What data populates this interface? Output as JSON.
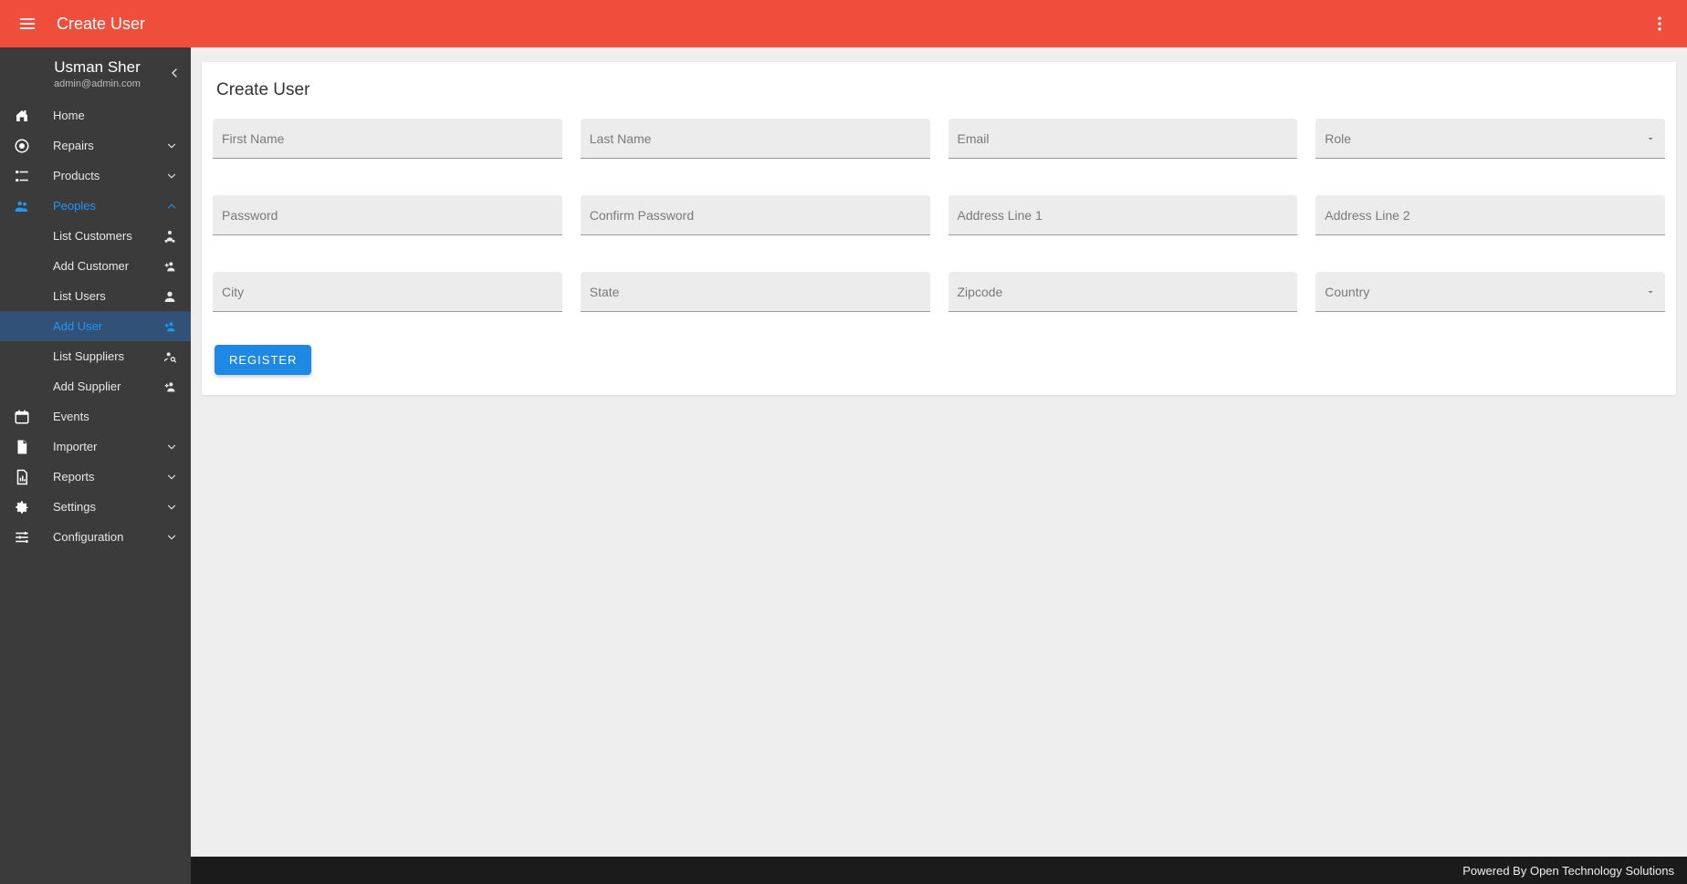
{
  "topbar": {
    "title": "Create User"
  },
  "user": {
    "name": "Usman Sher",
    "email": "admin@admin.com"
  },
  "sidebar": {
    "home": "Home",
    "repairs": "Repairs",
    "products": "Products",
    "peoples": "Peoples",
    "peoples_sub": {
      "list_customers": "List Customers",
      "add_customer": "Add Customer",
      "list_users": "List Users",
      "add_user": "Add User",
      "list_suppliers": "List Suppliers",
      "add_supplier": "Add Supplier"
    },
    "events": "Events",
    "importer": "Importer",
    "reports": "Reports",
    "settings": "Settings",
    "configuration": "Configuration"
  },
  "card": {
    "title": "Create User"
  },
  "form": {
    "first_name": "First Name",
    "last_name": "Last Name",
    "email": "Email",
    "role": "Role",
    "password": "Password",
    "confirm_password": "Confirm Password",
    "address1": "Address Line 1",
    "address2": "Address Line 2",
    "city": "City",
    "state": "State",
    "zipcode": "Zipcode",
    "country": "Country",
    "register": "REGISTER"
  },
  "footer": {
    "text": "Powered By Open Technology Solutions"
  }
}
